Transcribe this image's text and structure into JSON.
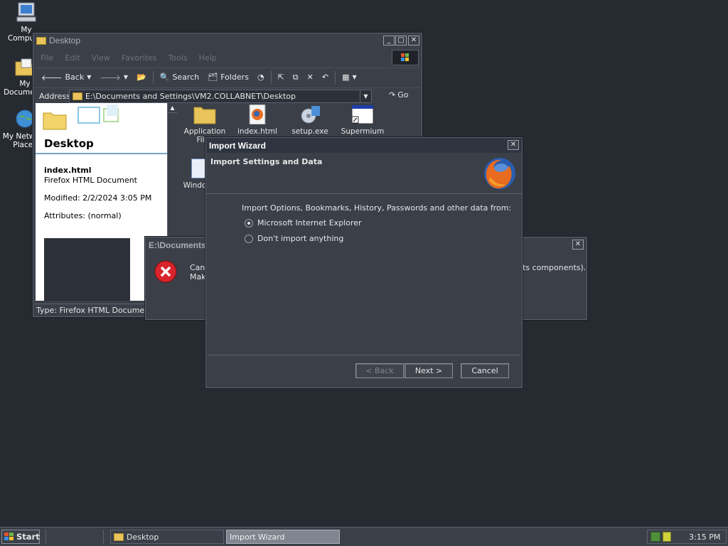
{
  "desktop": {
    "icons": [
      {
        "label": "My Computer"
      },
      {
        "label": "My Documents"
      },
      {
        "label": "My Network Places"
      }
    ]
  },
  "explorer": {
    "title": "Desktop",
    "menu": [
      "File",
      "Edit",
      "View",
      "Favorites",
      "Tools",
      "Help"
    ],
    "toolbar": {
      "back": "Back",
      "search": "Search",
      "folders": "Folders"
    },
    "address": {
      "label": "Address",
      "value": "E:\\Documents and Settings\\VM2.COLLABNET\\Desktop",
      "go": "Go"
    },
    "details": {
      "header": "Desktop",
      "filename": "index.html",
      "filetype": "Firefox HTML Document",
      "modified": "Modified: 2/2/2024 3:05 PM",
      "attributes": "Attributes: (normal)"
    },
    "files": [
      {
        "label": "Application Files",
        "icon": "folder-icon"
      },
      {
        "label": "index.html",
        "icon": "firefox-document-icon"
      },
      {
        "label": "setup.exe",
        "icon": "setup-icon"
      },
      {
        "label": "Supermium",
        "icon": "shortcut-icon"
      },
      {
        "label": "Windows",
        "icon": "file-icon"
      }
    ],
    "status": "Type: Firefox HTML Document S"
  },
  "error_dialog": {
    "title": "E:\\Documents",
    "message_left_1": "Cann",
    "message_left_2": "Mak",
    "message_right": "ts components)."
  },
  "wizard": {
    "title": "Import Wizard",
    "heading": "Import Settings and Data",
    "prompt": "Import Options, Bookmarks, History, Passwords and other data from:",
    "options": [
      {
        "label": "Microsoft Internet Explorer",
        "selected": true
      },
      {
        "label": "Don't import anything",
        "selected": false
      }
    ],
    "buttons": {
      "back": "< Back",
      "next": "Next >",
      "cancel": "Cancel"
    }
  },
  "taskbar": {
    "start": "Start",
    "tasks": [
      "Desktop",
      "Import Wizard"
    ],
    "clock": "3:15 PM"
  }
}
